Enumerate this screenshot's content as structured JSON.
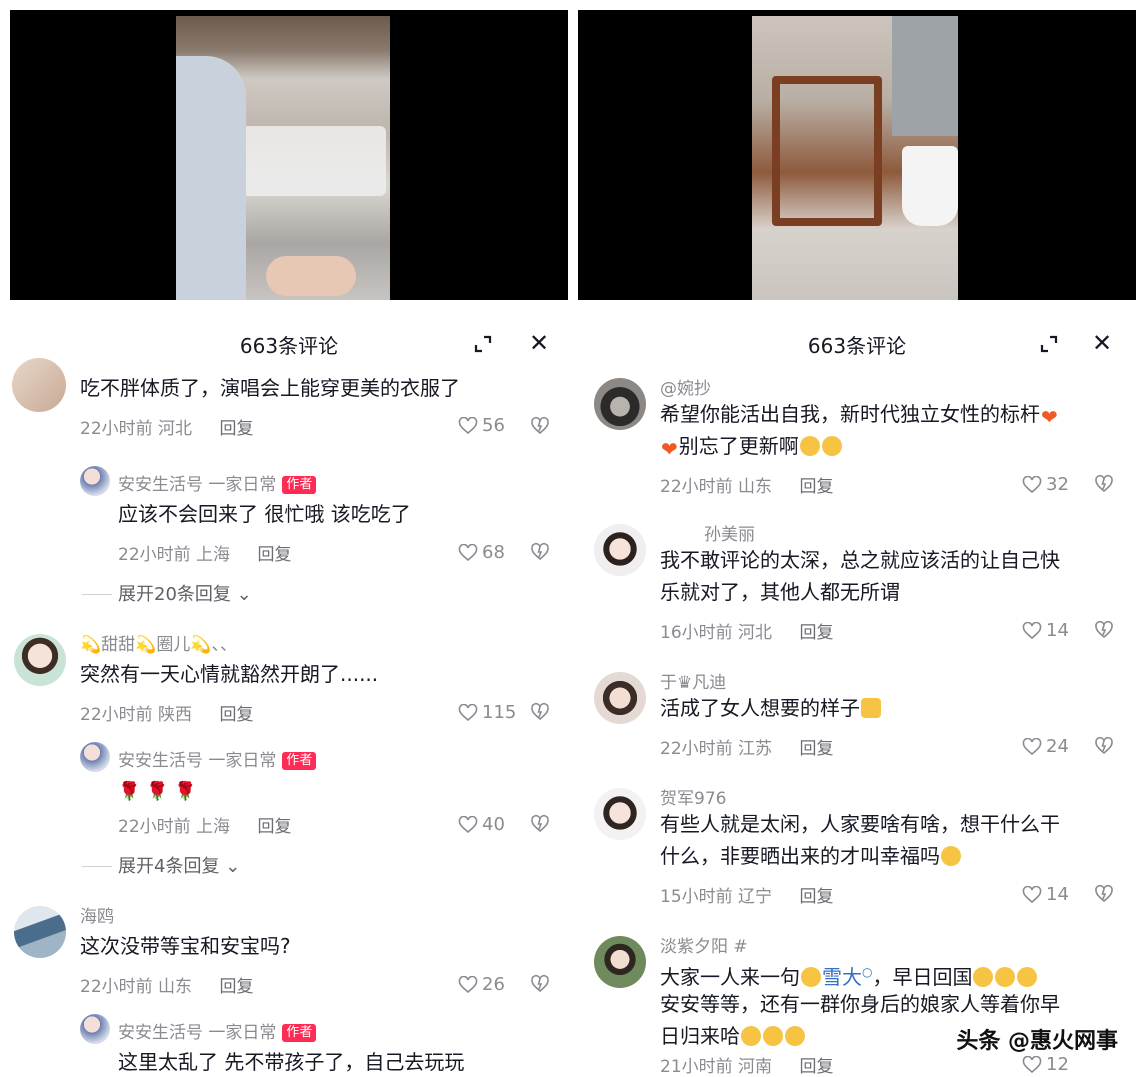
{
  "left": {
    "header": {
      "title": "663条评论"
    },
    "comments": [
      {
        "username": "",
        "text": "吃不胖体质了，演唱会上能穿更美的衣服了",
        "time": "22小时前",
        "location": "河北",
        "reply": "回复",
        "likes": "56"
      },
      {
        "username": "安安生活号 一家日常",
        "badge": "作者",
        "text": "应该不会回来了 很忙哦 该吃吃了",
        "time": "22小时前",
        "location": "上海",
        "reply": "回复",
        "likes": "68"
      },
      {
        "expand": "展开20条回复"
      },
      {
        "username": "💫甜甜💫圈儿💫、、",
        "text": "突然有一天心情就豁然开朗了......",
        "time": "22小时前",
        "location": "陕西",
        "reply": "回复",
        "likes": "115"
      },
      {
        "username": "安安生活号 一家日常",
        "badge": "作者",
        "text": "🌹 🌹 🌹",
        "time": "22小时前",
        "location": "上海",
        "reply": "回复",
        "likes": "40"
      },
      {
        "expand": "展开4条回复"
      },
      {
        "username": "海鸥",
        "text": "这次没带等宝和安宝吗?",
        "time": "22小时前",
        "location": "山东",
        "reply": "回复",
        "likes": "26"
      },
      {
        "username": "安安生活号 一家日常",
        "badge": "作者",
        "text": "这里太乱了 先不带孩子了，自己去玩玩"
      }
    ]
  },
  "right": {
    "header": {
      "title": "663条评论"
    },
    "comments": [
      {
        "username": "@婉抄",
        "text_line1": "希望你能活出自我，新时代独立女性的标杆",
        "text_line2": "别忘了更新啊",
        "time": "22小时前",
        "location": "山东",
        "reply": "回复",
        "likes": "32"
      },
      {
        "username": "孙美丽",
        "text_line1": "我不敢评论的太深，总之就应该活的让自己快",
        "text_line2": "乐就对了，其他人都无所谓",
        "time": "16小时前",
        "location": "河北",
        "reply": "回复",
        "likes": "14"
      },
      {
        "username": "于♛凡迪",
        "text_line1": "活成了女人想要的样子",
        "time": "22小时前",
        "location": "江苏",
        "reply": "回复",
        "likes": "24"
      },
      {
        "username": "贺军976",
        "text_line1": "有些人就是太闲，人家要啥有啥，想干什么干",
        "text_line2": "什么，非要晒出来的才叫幸福吗",
        "time": "15小时前",
        "location": "辽宁",
        "reply": "回复",
        "likes": "14"
      },
      {
        "username": "淡紫夕阳 #",
        "text_line1a": "大家一人来一句",
        "mention": "雪大",
        "text_line1b": "，早日回国",
        "text_line2": "安安等等，还有一群你身后的娘家人等着你早",
        "text_line3": "日归来哈",
        "time": "21小时前",
        "location": "河南",
        "reply": "回复",
        "likes": "12"
      }
    ]
  },
  "watermark": "头条 @惠火网事",
  "colors": {
    "accent": "#fe2c55",
    "secondary_text": "#8a8b91",
    "mention": "#3370c6"
  }
}
